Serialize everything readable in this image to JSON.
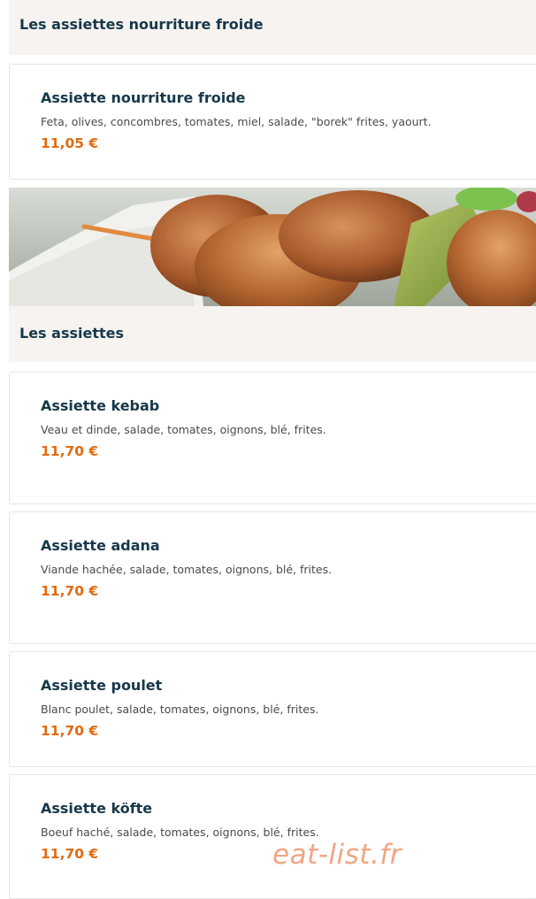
{
  "sections": [
    {
      "title": "Les assiettes nourriture froide",
      "items": [
        {
          "name": "Assiette nourriture froide",
          "description": "Feta, olives, concombres, tomates, miel, salade, \"borek\" frites, yaourt.",
          "price": "11,05 €"
        }
      ]
    },
    {
      "title": "Les assiettes",
      "items": [
        {
          "name": "Assiette kebab",
          "description": "Veau et dinde, salade, tomates, oignons, blé, frites.",
          "price": "11,70 €"
        },
        {
          "name": "Assiette adana",
          "description": "Viande hachée, salade, tomates, oignons, blé, frites.",
          "price": "11,70 €"
        },
        {
          "name": "Assiette poulet",
          "description": "Blanc poulet, salade, tomates, oignons, blé, frites.",
          "price": "11,70 €"
        },
        {
          "name": "Assiette köfte",
          "description": "Boeuf haché, salade, tomates, oignons, blé, frites.",
          "price": "11,70 €"
        }
      ]
    }
  ],
  "watermark": "eat-list.fr",
  "colors": {
    "heading": "#17384a",
    "price": "#e06b12",
    "section_bg": "#f6f3f0",
    "watermark": "#f2a583"
  }
}
